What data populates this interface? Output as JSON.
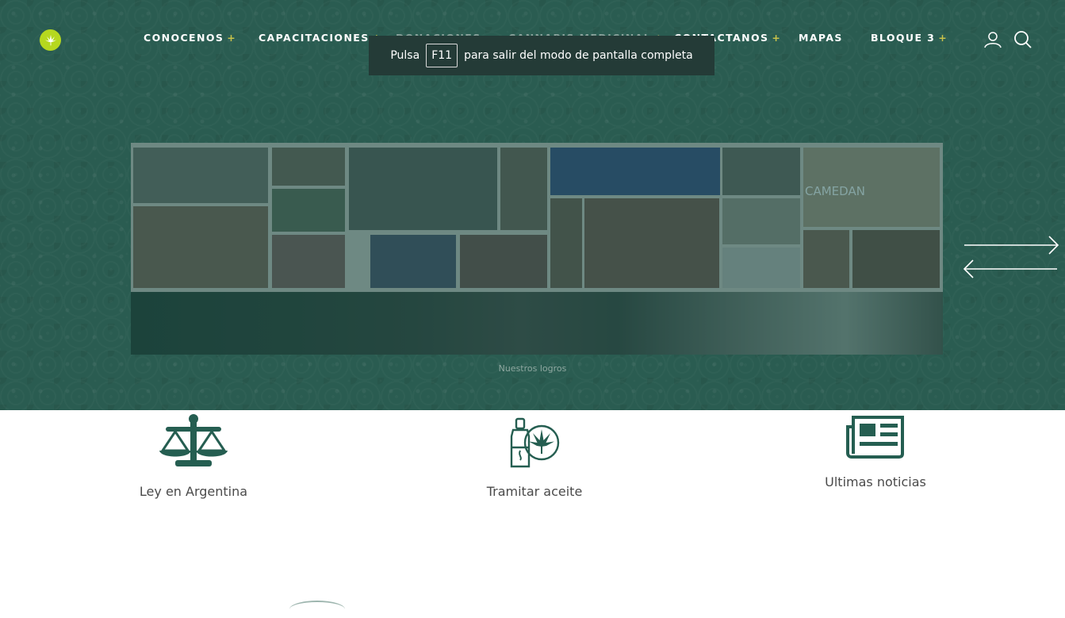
{
  "nav": {
    "items": [
      {
        "label": "CONOCENOS",
        "plus": "+"
      },
      {
        "label": "CAPACITACIONES",
        "plus": "+"
      },
      {
        "label": "DONACIONES",
        "plus": ""
      },
      {
        "label": "CANNABIS MEDICINAL",
        "plus": "+"
      },
      {
        "label": "CONTACTANOS",
        "plus": "+"
      },
      {
        "label": "MAPAS",
        "plus": ""
      },
      {
        "label": "BLOQUE 3",
        "plus": "+"
      }
    ],
    "icons": {
      "logo": "cannabis-leaf-icon",
      "user": "user-icon",
      "search": "search-icon"
    }
  },
  "fullscreen_banner": {
    "prefix": "Pulsa",
    "key": "F11",
    "suffix": "para salir del modo de pantalla completa"
  },
  "slider": {
    "caption": "Nuestros logros",
    "collage_banner_text": "CAMEDAN",
    "arrow_icon": "double-arrow-icon"
  },
  "features": [
    {
      "label": "Ley en Argentina",
      "icon": "scales-icon"
    },
    {
      "label": "Tramitar aceite",
      "icon": "oil-bottle-cannabis-icon"
    },
    {
      "label": "Ultimas noticias",
      "icon": "newspaper-icon"
    }
  ],
  "colors": {
    "hero_bg": "#2a5c51",
    "accent": "#c9c24a",
    "logo": "#b6d81f",
    "icon": "#255e51"
  }
}
